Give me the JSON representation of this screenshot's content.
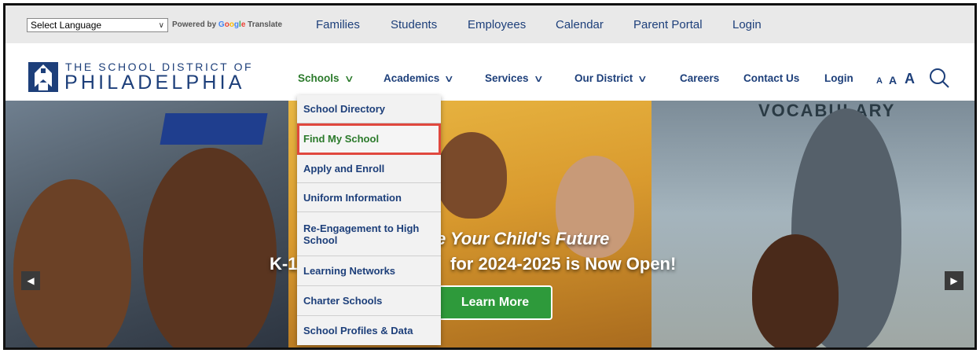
{
  "topbar": {
    "language_select": "Select Language",
    "powered_by": "Powered by",
    "google_letters": [
      "G",
      "o",
      "o",
      "g",
      "l",
      "e"
    ],
    "translate": "Translate",
    "links": [
      "Families",
      "Students",
      "Employees",
      "Calendar",
      "Parent Portal",
      "Login"
    ]
  },
  "header": {
    "logo_line1": "THE SCHOOL DISTRICT OF",
    "logo_line2": "PHILADELPHIA",
    "nav": [
      {
        "label": "Schools",
        "chevron": "∨"
      },
      {
        "label": "Academics",
        "chevron": "∨"
      },
      {
        "label": "Services",
        "chevron": "∨"
      },
      {
        "label": "Our District",
        "chevron": "∨"
      },
      {
        "label": "Careers"
      },
      {
        "label": "Contact Us"
      },
      {
        "label": "Login"
      }
    ],
    "font_size_labels": [
      "A",
      "A",
      "A"
    ]
  },
  "dropdown": {
    "items": [
      "School Directory",
      "Find My School",
      "Apply and Enroll",
      "Uniform Information",
      "Re-Engagement to High School",
      "Learning Networks",
      "Charter Schools",
      "School Profiles & Data"
    ]
  },
  "hero": {
    "headline1": "e Your Child's Future",
    "headline2_left": "K-1",
    "headline2_right": "for 2024-2025 is Now Open!",
    "cta": "Learn More",
    "background_text": "VOCABULARY",
    "prev_arrow": "◀",
    "next_arrow": "▶"
  },
  "colors": {
    "brand_blue": "#1d3f7a",
    "active_green": "#2b7a2b",
    "cta_green": "#2e9a3b",
    "highlight_red": "#e0483e"
  }
}
